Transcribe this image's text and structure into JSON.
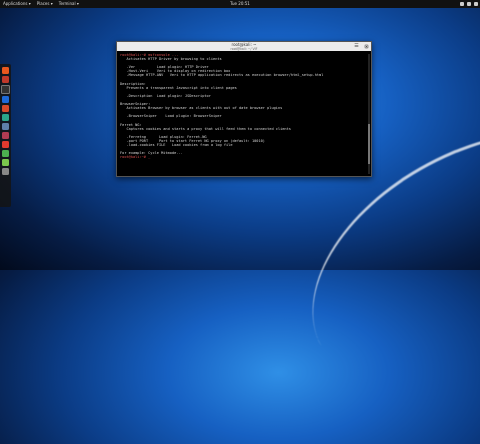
{
  "topbar": {
    "applications": "Applications ▾",
    "places": "Places ▾",
    "terminal_menu": "Terminal ▾",
    "clock": "Tue 20:51"
  },
  "window": {
    "title": "root@kali: ~",
    "subtitle": "root@kali: ~/ VIF"
  },
  "terminal_lines": [
    "root@kali:~# msfconsole ...",
    "   Activates HTTP Driver by browsing to clients",
    "",
    "   -Ver          Load plugin: HTTP Driver",
    "   -Host-Veri    Veri to display on redirection box",
    "   -Message HTTP-ANV   Veri to HTTP application redirects as execution browser/html_setup.html",
    "",
    "Description:",
    "   Presents a transparent Javascript into client pages",
    "",
    "   -Description  Load plugin: JSDescriptor",
    "",
    "BrowserSniper:",
    "   Activates Browser by browser as clients with out of date browser plugins",
    "",
    "   -BrowserSniper    Load plugin: BrowserSniper",
    "",
    "Ferret NG:",
    "   Captures cookies and starts a proxy that will feed them to connected clients",
    "",
    "   -Ferretng      Load plugin: Ferret-NG",
    "   -port PORT     Port to start Ferret NG proxy on (default: 10010)",
    "   -load-cookies FILE   Load cookies from a log file",
    "",
    "For example: Cycle Mitmode...",
    "root@kali:~# _"
  ]
}
